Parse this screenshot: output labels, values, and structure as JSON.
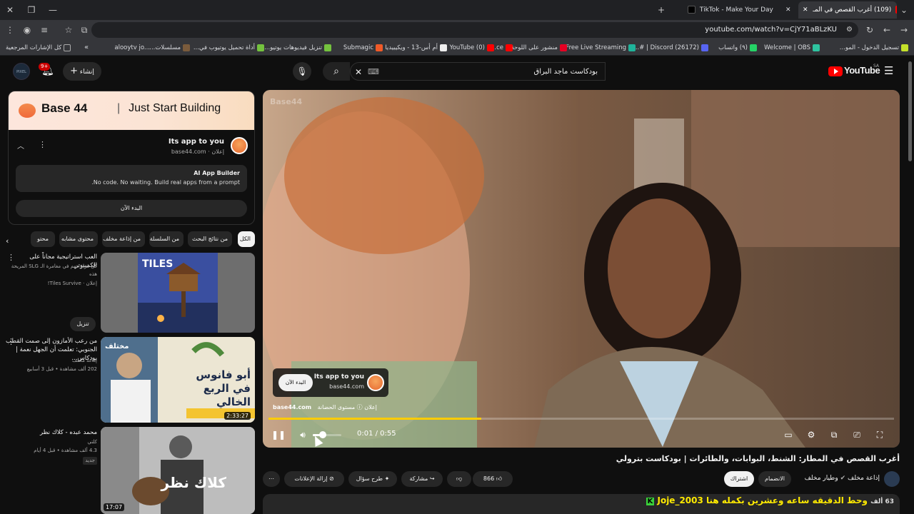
{
  "browser": {
    "tabs": [
      {
        "label": "TikTok - Make Your Day"
      },
      {
        "label": "(109) أغرب القصص في المـ"
      }
    ],
    "url": "youtube.com/watch?v=CjY71aBLzKU",
    "bookmarks": [
      "تسجيل الدخول - المو...",
      "Welcome | OBS",
      "(٩) واتساب",
      "(26172) Discord | #...",
      "Free Live Streaming...",
      "منشور على اللوحة...",
      "ce...",
      "(0) YouTube",
      "أم أس-13 - ويكيبيديا",
      "Submagic",
      "تنزيل فيديوهات يوتيو...",
      "أداة تحميل يوتيوب في...",
      "مسلسلات...",
      "alooytv jo...",
      "كل الإشارات المرجعية"
    ]
  },
  "header": {
    "search_query": "بودكاست ماجد البراق",
    "create_label": "إنشاء",
    "notif_count": "9+",
    "logo_text": "YouTube",
    "logo_region": "SA"
  },
  "ad": {
    "banner_brand": "Base 44",
    "banner_tag": "Just Start Building",
    "title": "Its app to you",
    "sponsor": "إعلان · base44.com",
    "card_title": "AI App Builder",
    "card_desc": ".No code. No waiting. Build real apps from a prompt",
    "cta": "البدء الآن"
  },
  "chips": [
    "الكل",
    "من نتائج البحث",
    "من السلسلة",
    "من إذاعة مخلف",
    "محتوى مشابه",
    "محتو"
  ],
  "recs": [
    {
      "title": "العب استراتيجية مجاناً على الكمبيوتر",
      "meta1": "كل قرار مهم في مغامرة الـ SLG المريحة هذه",
      "meta2": "إعلان · Tiles Survive!",
      "button": "تنزيل"
    },
    {
      "title": "من رعب الأمازون إلى صمت القطب الجنوبي: تعلمت أن الجهل نعمة | بودكاس...",
      "meta1": "إذاعة مخلف",
      "meta2": "202 ألف مشاهدة • قبل 3 أسابيع",
      "duration": "2:33:27",
      "thumb_text": "أبو فانوس في الربع الخالي",
      "thumb_tag": "مختلف"
    },
    {
      "title": "محمد عبده - كلاك نظر",
      "meta1": "كلتي",
      "meta2": "4.3 ألف مشاهدة • قبل 4 أيام",
      "badge": "جديد",
      "duration": "17:07",
      "thumb_text": "كلاك نظر"
    }
  ],
  "player": {
    "watermark": "Base44",
    "overlay_title": "Its app to you",
    "overlay_site": "base44.com",
    "overlay_cta": "البدء الآن",
    "ad_site": "base44.com",
    "ad_label": "إعلان",
    "ad_audience": "مستوى الحضانة",
    "time": "0:01 / 0:55",
    "progress": 0.34,
    "volume": 0.35
  },
  "video": {
    "title": "أغرب القصص في المطار: الشنط، البوابات، والطائرات | بودكاست بترولي",
    "channel": "إذاعة مخلف",
    "channel_extra": "وطيار مخلف",
    "join": "الانضمام",
    "subscribe": "اشتراك",
    "likes": "866",
    "share": "مشاركة",
    "ask": "طرح سؤال",
    "remove_ads": "إزالة الإعلانات"
  },
  "description": {
    "username": "Joje_2003",
    "highlight": "وحط الدقيقه ساعه وعشرين بكمله هنا",
    "count": "63 ألف"
  }
}
